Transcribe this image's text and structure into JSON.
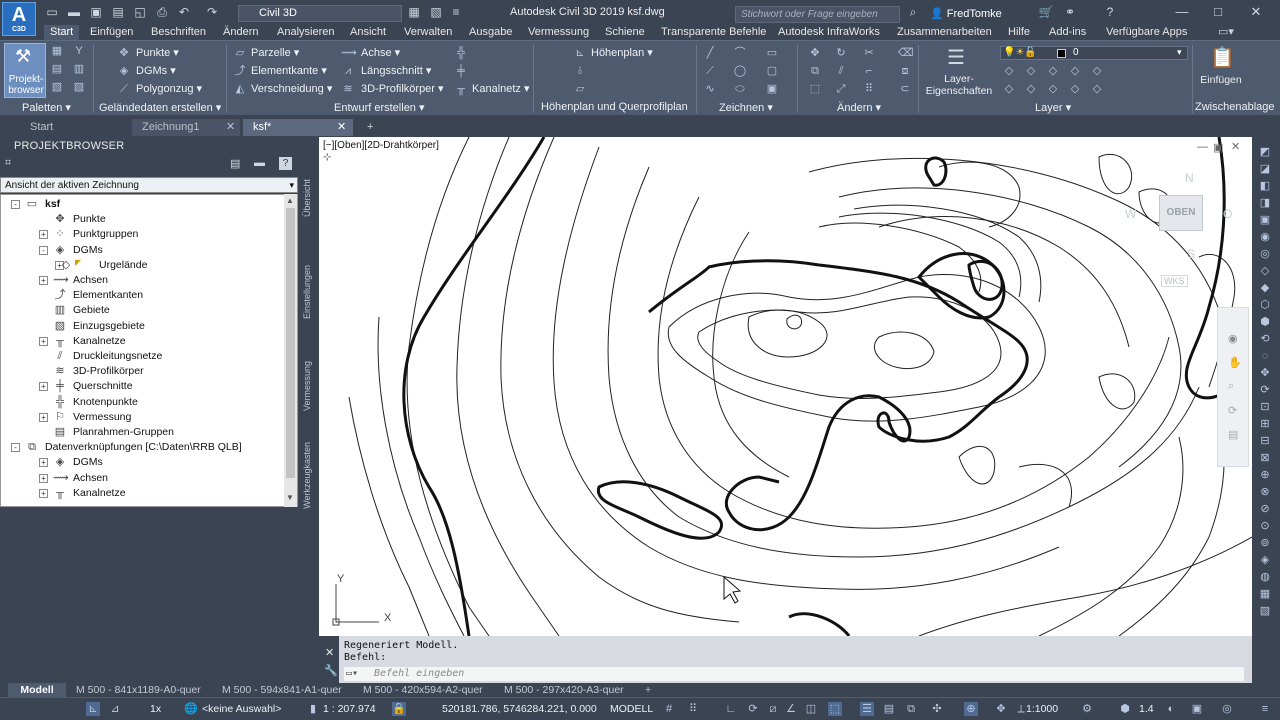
{
  "app": {
    "logo_text": "A",
    "logo_sub": "C3D",
    "workspace": "Civil 3D",
    "title": "Autodesk Civil 3D 2019    ksf.dwg",
    "search_placeholder": "Stichwort oder Frage eingeben",
    "user": "FredTomke"
  },
  "ribbon_tabs": [
    "Start",
    "Einfügen",
    "Beschriften",
    "Ändern",
    "Analysieren",
    "Ansicht",
    "Verwalten",
    "Ausgabe",
    "Vermessung",
    "Schiene",
    "Transparente Befehle",
    "Autodesk InfraWorks",
    "Zusammenarbeiten",
    "Hilfe",
    "Add-ins",
    "Verfügbare Apps"
  ],
  "ribbon": {
    "projektbrowser": "Projekt-\nbrowser",
    "punkte": "Punkte",
    "dgms": "DGMs",
    "polygonzug": "Polygonzug",
    "parzelle": "Parzelle",
    "elementkante": "Elementkante",
    "verschneidung": "Verschneidung",
    "achse": "Achse",
    "laengsschnitt": "Längsschnitt",
    "profilkoerper": "3D-Profilkörper",
    "kanalnetz": "Kanalnetz",
    "hoehenplan": "Höhenplan",
    "layer_eigenschaften": "Layer-\nEigenschaften",
    "layer_value": "0",
    "einfuegen": "Einfügen",
    "panels": {
      "paletten": "Paletten",
      "gelaendedaten": "Geländedaten erstellen",
      "entwurf": "Entwurf erstellen",
      "hoehenplan_qp": "Höhenplan und Querprofilplan",
      "zeichnen": "Zeichnen",
      "aendern": "Ändern",
      "layer": "Layer",
      "zwischenablage": "Zwischenablage"
    }
  },
  "doc_tabs": [
    "Start",
    "Zeichnung1",
    "ksf*"
  ],
  "project_browser": {
    "title": "PROJEKTBROWSER",
    "view_select": "Ansicht der aktiven Zeichnung",
    "tree": [
      {
        "label": "ksf",
        "level": 0,
        "toggle": "-",
        "icon": "drawing-icon",
        "bold": true
      },
      {
        "label": "Punkte",
        "level": 1,
        "toggle": "",
        "icon": "points-icon"
      },
      {
        "label": "Punktgruppen",
        "level": 1,
        "toggle": "+",
        "icon": "point-groups-icon"
      },
      {
        "label": "DGMs",
        "level": 1,
        "toggle": "-",
        "icon": "surfaces-icon"
      },
      {
        "label": "Urgelände",
        "level": 2,
        "toggle": "+",
        "icon": "surface-icon"
      },
      {
        "label": "Achsen",
        "level": 1,
        "toggle": "+",
        "icon": "alignments-icon"
      },
      {
        "label": "Elementkanten",
        "level": 1,
        "toggle": "",
        "icon": "feature-lines-icon"
      },
      {
        "label": "Gebiete",
        "level": 1,
        "toggle": "",
        "icon": "sites-icon"
      },
      {
        "label": "Einzugsgebiete",
        "level": 1,
        "toggle": "",
        "icon": "catchments-icon"
      },
      {
        "label": "Kanalnetze",
        "level": 1,
        "toggle": "+",
        "icon": "pipe-networks-icon"
      },
      {
        "label": "Druckleitungsnetze",
        "level": 1,
        "toggle": "",
        "icon": "pressure-networks-icon"
      },
      {
        "label": "3D-Profilkörper",
        "level": 1,
        "toggle": "",
        "icon": "corridors-icon"
      },
      {
        "label": "Querschnitte",
        "level": 1,
        "toggle": "+",
        "icon": "assemblies-icon"
      },
      {
        "label": "Knotenpunkte",
        "level": 1,
        "toggle": "",
        "icon": "intersections-icon"
      },
      {
        "label": "Vermessung",
        "level": 1,
        "toggle": "+",
        "icon": "survey-icon"
      },
      {
        "label": "Planrahmen-Gruppen",
        "level": 1,
        "toggle": "",
        "icon": "view-frame-groups-icon"
      },
      {
        "label": "Datenverknüpfungen [C:\\Daten\\RRB QLB]",
        "level": 0,
        "toggle": "-",
        "icon": "data-shortcuts-icon"
      },
      {
        "label": "DGMs",
        "level": 1,
        "toggle": "+",
        "icon": "surfaces-icon"
      },
      {
        "label": "Achsen",
        "level": 1,
        "toggle": "+",
        "icon": "alignments-icon"
      },
      {
        "label": "Kanalnetze",
        "level": 1,
        "toggle": "+",
        "icon": "pipe-networks-icon"
      }
    ],
    "side_tabs": [
      "Übersicht",
      "Einstellungen",
      "Vermessung",
      "Werkzeugkasten"
    ]
  },
  "viewport": {
    "label": "[−][Oben][2D-Drahtkörper]",
    "viewcube_top": "OBEN",
    "compass": {
      "n": "N",
      "s": "S",
      "w": "W",
      "o": "O"
    },
    "wks": "WKS",
    "ucs_y": "Y",
    "ucs_x": "X"
  },
  "command": {
    "history": [
      "Regeneriert Modell.",
      "Befehl:"
    ],
    "placeholder": "Befehl eingeben"
  },
  "layout_tabs": [
    "Modell",
    "M 500 - 841x1189-A0-quer",
    "M 500 - 594x841-A1-quer",
    "M 500 - 420x594-A2-quer",
    "M 500 - 297x420-A3-quer"
  ],
  "status": {
    "scale_factor": "1x",
    "selection": "<keine Auswahl>",
    "scale": "1 : 207.974",
    "coords": "520181.786, 5746284.221, 0.000",
    "space": "MODELL",
    "annotation_scale": "1:1000",
    "lineweight": "1.4"
  }
}
